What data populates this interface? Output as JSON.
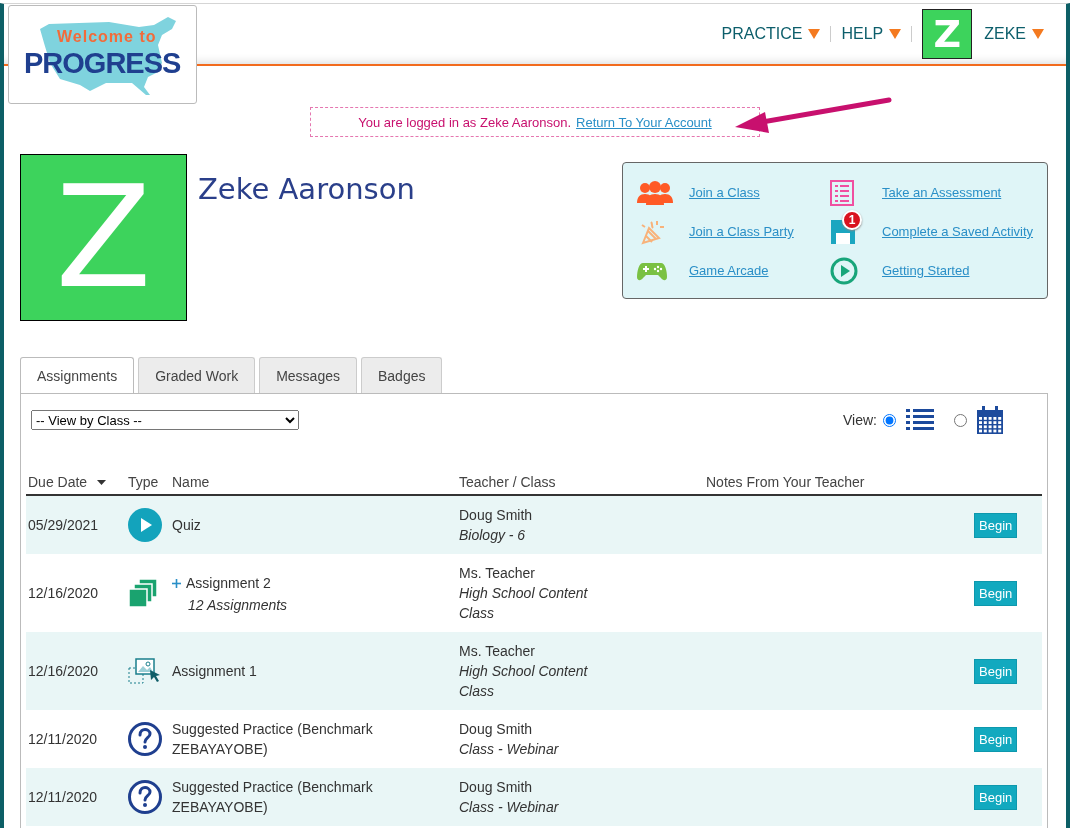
{
  "logo": {
    "line1": "Welcome to",
    "line2": "PROGRESS"
  },
  "nav": [
    {
      "label": "PRACTICE"
    },
    {
      "label": "HELP"
    }
  ],
  "user": {
    "avatar_letter": "Z",
    "name": "ZEKE"
  },
  "notice": {
    "text": "You are logged in as Zeke Aaronson.",
    "link": "Return To Your Account"
  },
  "profile": {
    "avatar_letter": "Z",
    "name": "Zeke Aaronson"
  },
  "quick_links": [
    {
      "kind": "people",
      "label": "Join a Class"
    },
    {
      "kind": "checklist",
      "label": "Take an Assessment"
    },
    {
      "kind": "party",
      "label": "Join a Class Party"
    },
    {
      "kind": "save",
      "label": "Complete a Saved Activity",
      "badge": "1"
    },
    {
      "kind": "gamepad",
      "label": "Game Arcade"
    },
    {
      "kind": "play",
      "label": "Getting Started"
    }
  ],
  "tabs": [
    {
      "label": "Assignments",
      "selected": true
    },
    {
      "label": "Graded Work",
      "selected": false
    },
    {
      "label": "Messages",
      "selected": false
    },
    {
      "label": "Badges",
      "selected": false
    }
  ],
  "filter": {
    "value": "-- View by Class --"
  },
  "view": {
    "label": "View:",
    "options": [
      {
        "kind": "list",
        "selected": true
      },
      {
        "kind": "calendar",
        "selected": false
      }
    ]
  },
  "table": {
    "columns": [
      "Due Date",
      "Type",
      "Name",
      "Teacher / Class",
      "Notes From Your Teacher"
    ],
    "rows": [
      {
        "due": "05/29/2021",
        "kind": "play",
        "name": "Quiz",
        "teacher": "Doug Smith",
        "class": "Biology - 6",
        "action": "Begin"
      },
      {
        "due": "12/16/2020",
        "kind": "stack",
        "name": "Assignment 2",
        "group": {
          "expanded": false,
          "count": "12 Assignments"
        },
        "teacher": "Ms. Teacher",
        "class": "High School Content Class",
        "action": "Begin"
      },
      {
        "due": "12/16/2020",
        "kind": "image-select",
        "name": "Assignment 1",
        "teacher": "Ms. Teacher",
        "class": "High School Content Class",
        "action": "Begin"
      },
      {
        "due": "12/11/2020",
        "kind": "question",
        "name": "Suggested Practice (Benchmark ZEBAYAYOBE)",
        "teacher": "Doug Smith",
        "class": "Class - Webinar",
        "action": "Begin"
      },
      {
        "due": "12/11/2020",
        "kind": "question",
        "name": "Suggested Practice (Benchmark ZEBAYAYOBE)",
        "teacher": "Doug Smith",
        "class": "Class - Webinar",
        "action": "Begin"
      }
    ]
  }
}
